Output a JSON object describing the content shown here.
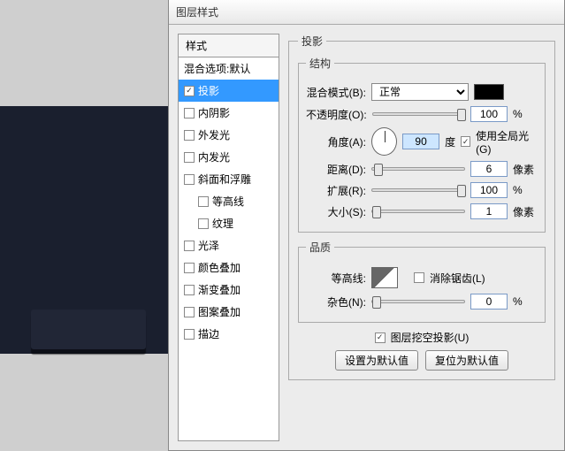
{
  "title": "图层样式",
  "styles": {
    "header": "样式",
    "items": [
      {
        "label": "混合选项:默认",
        "checked": false,
        "sel": false
      },
      {
        "label": "投影",
        "checked": true,
        "sel": true
      },
      {
        "label": "内阴影",
        "checked": false,
        "sel": false
      },
      {
        "label": "外发光",
        "checked": false,
        "sel": false
      },
      {
        "label": "内发光",
        "checked": false,
        "sel": false
      },
      {
        "label": "斜面和浮雕",
        "checked": false,
        "sel": false
      },
      {
        "label": "等高线",
        "checked": false,
        "sel": false,
        "indent": true
      },
      {
        "label": "纹理",
        "checked": false,
        "sel": false,
        "indent": true
      },
      {
        "label": "光泽",
        "checked": false,
        "sel": false
      },
      {
        "label": "颜色叠加",
        "checked": false,
        "sel": false
      },
      {
        "label": "渐变叠加",
        "checked": false,
        "sel": false
      },
      {
        "label": "图案叠加",
        "checked": false,
        "sel": false
      },
      {
        "label": "描边",
        "checked": false,
        "sel": false
      }
    ]
  },
  "section": {
    "title": "投影",
    "structure": {
      "title": "结构",
      "blend_label": "混合模式(B):",
      "blend_value": "正常",
      "opacity_label": "不透明度(O):",
      "opacity_value": "100",
      "pct": "%",
      "angle_label": "角度(A):",
      "angle_value": "90",
      "degree": "度",
      "global_light_label": "使用全局光(G)",
      "distance_label": "距离(D):",
      "distance_value": "6",
      "px": "像素",
      "spread_label": "扩展(R):",
      "spread_value": "100",
      "size_label": "大小(S):",
      "size_value": "1"
    },
    "quality": {
      "title": "品质",
      "contour_label": "等高线:",
      "antialias_label": "消除锯齿(L)",
      "noise_label": "杂色(N):",
      "noise_value": "0"
    },
    "knockout_label": "图层挖空投影(U)",
    "set_default": "设置为默认值",
    "reset_default": "复位为默认值"
  }
}
